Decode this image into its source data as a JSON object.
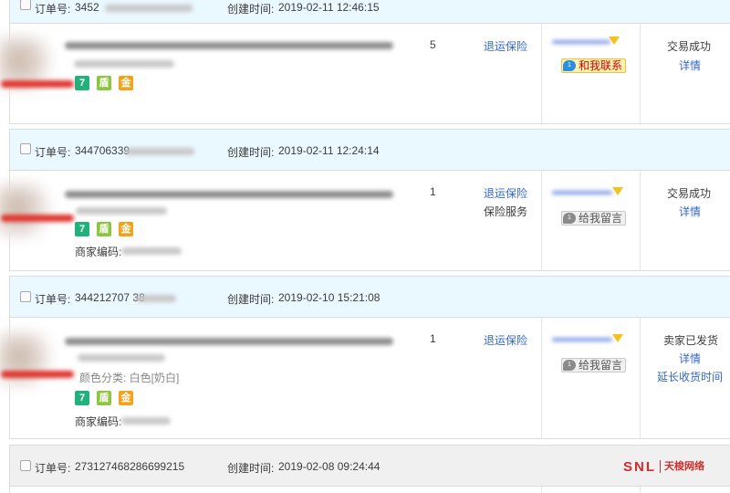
{
  "labels": {
    "order_no": "订单号:",
    "created": "创建时间:",
    "merchant_code": "商家编码:",
    "color_class": "颜色分类: 白色[奶白]"
  },
  "orders": [
    {
      "order_no": "3452",
      "created_time": "2019-02-11 12:46:15",
      "quantity": "5",
      "service_links": [
        "退运保险"
      ],
      "contact_label": "和我联系",
      "contact_state": "online",
      "status": "交易成功",
      "actions": [
        "详情"
      ]
    },
    {
      "order_no": "344706339",
      "created_time": "2019-02-11 12:24:14",
      "quantity": "1",
      "service_links": [
        "退运保险"
      ],
      "service_text": "保险服务",
      "contact_label": "给我留言",
      "contact_state": "offline",
      "status": "交易成功",
      "actions": [
        "详情"
      ]
    },
    {
      "order_no": "344212707 38",
      "created_time": "2019-02-10 15:21:08",
      "quantity": "1",
      "service_links": [
        "退运保险"
      ],
      "contact_label": "给我留言",
      "contact_state": "offline",
      "status": "卖家已发货",
      "actions": [
        "详情",
        "延长收货时间"
      ]
    },
    {
      "order_no": "273127468286699215",
      "created_time": "2019-02-08 09:24:44",
      "logo_text": "SNL",
      "logo_sub": "天梭网络"
    }
  ],
  "badges": [
    "7",
    "盾",
    "金"
  ],
  "icons": {
    "contact": "wangwang-chat-icon",
    "flag": "seller-flag-icon"
  },
  "colors": {
    "header_bg": "#eaf8ff",
    "link": "#3366cc",
    "badge_seven": "#22b07d",
    "badge_lock": "#8cc63f",
    "badge_gold": "#f4a21c",
    "logo_red": "#d42b2b"
  }
}
